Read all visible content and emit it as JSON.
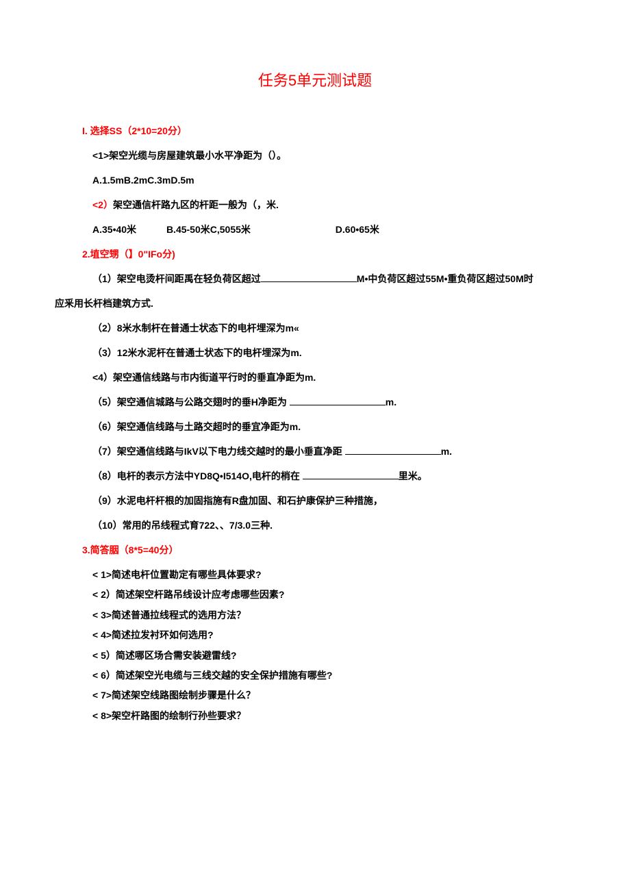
{
  "title": "任务5单元测试题",
  "section1": {
    "heading": "I. 选择SS（2*10=20分）",
    "q1": {
      "label": "<1>",
      "text": "架空光缆与房屋建筑最小水平净距为（）。",
      "options": "A.1.5mB.2mC.3mD.5m"
    },
    "q2": {
      "label": "<2）",
      "text": "架空通信杆路九区的杆距一般为（，米.",
      "optA": "A.35•40米",
      "optB": "B.45-50米C,5055米",
      "optD": "D.60•65米"
    }
  },
  "section2": {
    "heading": "2.埴空甥（】0\"IFo分)",
    "q1": {
      "prefix": "（1）",
      "text1": "架空电烫杆间距禹在轻负荷区超过",
      "text2": "M•中负荷区超过55M•重负荷区超过50M时",
      "cont": "应釆用长杆档建筑方式."
    },
    "q2": "（2）8米水制杆在普通士状态下的电杆埋深为m«",
    "q3": "（3）12米水泥杆在普通士状态下的电杆埋深为m.",
    "q4": "<4）架空通信线路与市内街道平行时的垂直净距为m.",
    "q5": {
      "prefix": "（5）",
      "text1": "架空通信城路与公路交翅时的垂H净距为",
      "suffix": "m."
    },
    "q6": "（6）架空通信线路与土路交超时的垂宜净距为m.",
    "q7": {
      "prefix": "（7）",
      "text1": "架空通信线路与IkV以下电力线交越时的最小垂直净距",
      "suffix": "m."
    },
    "q8": {
      "prefix": "（8）",
      "text1": "电杆的表示方法中YD8Q•I514O,电杆的梢在",
      "suffix": "里米。"
    },
    "q9": "（9）水泥电杆杆根的加固指施有R盘加固、和石护康保护三种措施，",
    "q10": "（10）常用的吊线程式育722、、7/3.0三种."
  },
  "section3": {
    "heading": "3.简答胭（8*5=40分）",
    "q1": "< 1>简述电杆位置勘定有哪些具体要求?",
    "q2": "< 2）简述架空杆路吊线设计应考虑哪些因素?",
    "q3": "< 3>简述普通拉线程式的选用方法？",
    "q4": "< 4>简述拉发衬环如何选用?",
    "q5": "< 5）简述哪区场合需安装避雷线?",
    "q6": "< 6）简述架空光电缆与三线交越的安全保护措施有哪些?",
    "q7": "< 7>简述架空线路图绘制步骤是什么？",
    "q8": "< 8>架空杆路图的绘制行孙些要求？"
  }
}
